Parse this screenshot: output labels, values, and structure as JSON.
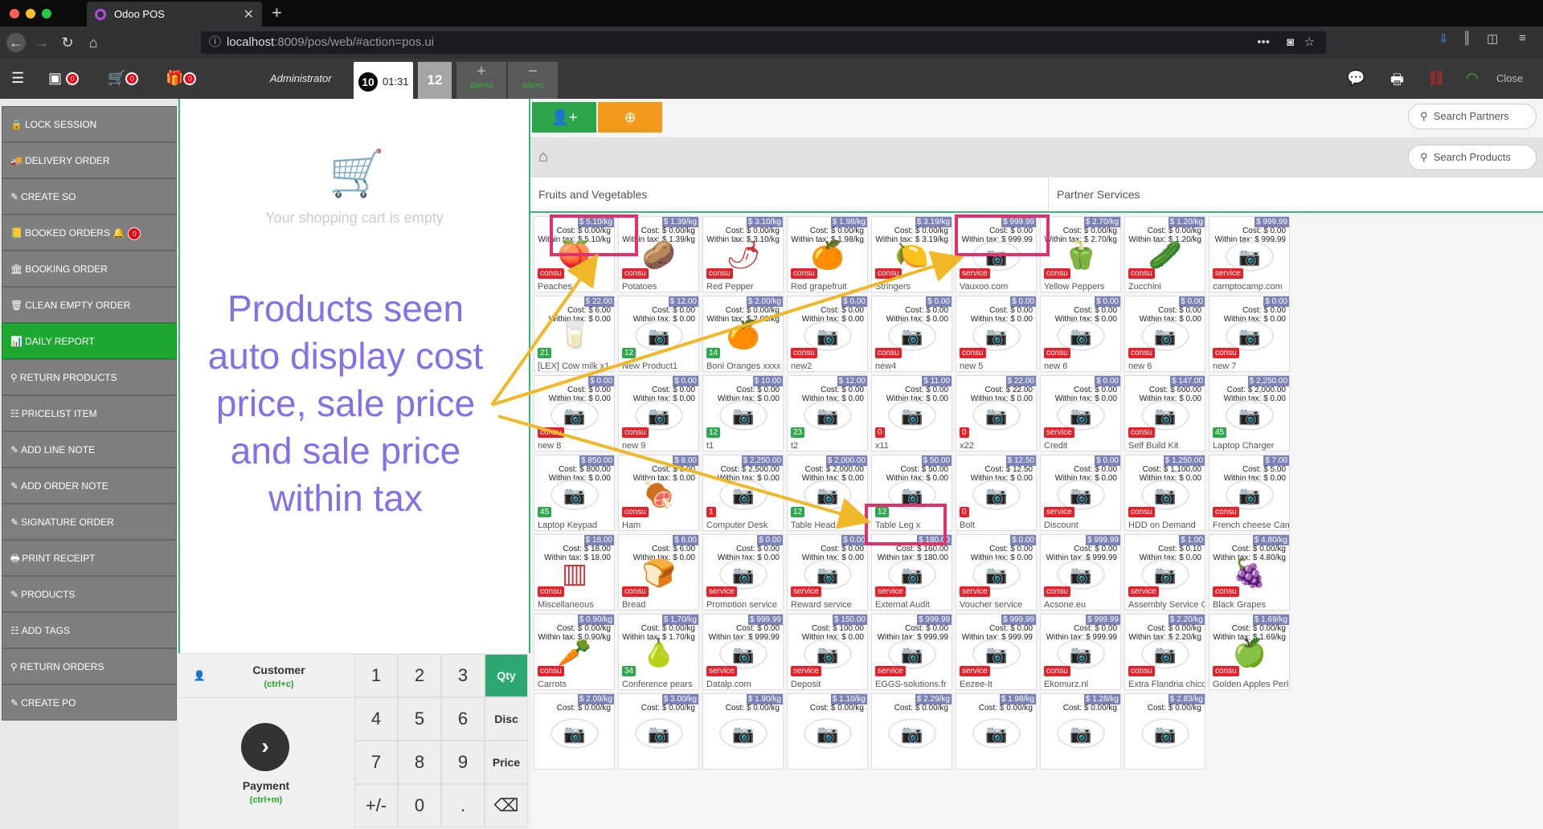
{
  "browser": {
    "tab_title": "Odoo POS",
    "url_host": "localhost",
    "url_port": ":8009",
    "url_path": "/pos/web/#action=pos.ui"
  },
  "header": {
    "cash_count": "0",
    "cart_count": "0",
    "gift_count": "0",
    "admin": "Administrator",
    "order_num": "10",
    "order_time": "01:31",
    "order2": "12",
    "add_hint": "(ctrl+n)",
    "remove_hint": "(ctrl+r)",
    "close": "Close"
  },
  "left_buttons": [
    "LOCK SESSION",
    "DELIVERY ORDER",
    "CREATE SO",
    "BOOKED ORDERS",
    "BOOKING ORDER",
    "CLEAN EMPTY ORDER",
    "DAILY REPORT",
    "RETURN PRODUCTS",
    "PRICELIST ITEM",
    "ADD LINE NOTE",
    "ADD ORDER NOTE",
    "SIGNATURE ORDER",
    "PRINT RECEIPT",
    "PRODUCTS",
    "ADD TAGS",
    "RETURN ORDERS",
    "CREATE PO"
  ],
  "booked_badge": "0",
  "cart": {
    "empty": "Your shopping cart is empty"
  },
  "annotation": "Products seen auto display cost price, sale price and sale price within tax",
  "actionpad": {
    "customer": "Customer",
    "customer_hint": "(ctrl+c)",
    "payment": "Payment",
    "payment_hint": "(ctrl+m)"
  },
  "numpad": {
    "keys": [
      "1",
      "2",
      "3",
      "4",
      "5",
      "6",
      "7",
      "8",
      "9",
      "+/-",
      "0",
      "."
    ],
    "modes": [
      "Qty",
      "Disc",
      "Price"
    ]
  },
  "search": {
    "partners": "Search Partners",
    "products": "Search Products"
  },
  "categories": [
    "Fruits and Vegetables",
    "Partner Services"
  ],
  "products": [
    {
      "name": "Peaches",
      "price": "$ 5.10/kg",
      "cost": "Cost: $ 0.00/kg",
      "tax": "Within tax: $ 5.10/kg",
      "tag": "consu",
      "tc": "red"
    },
    {
      "name": "Potatoes",
      "price": "$ 1.39/kg",
      "cost": "Cost: $ 0.00/kg",
      "tax": "Within tax: $ 1.39/kg",
      "tag": "consu",
      "tc": "red"
    },
    {
      "name": "Red Pepper",
      "price": "$ 3.10/kg",
      "cost": "Cost: $ 0.00/kg",
      "tax": "Within tax: $ 3.10/kg",
      "tag": "consu",
      "tc": "red"
    },
    {
      "name": "Red grapefruit",
      "price": "$ 1.98/kg",
      "cost": "Cost: $ 0.00/kg",
      "tax": "Within tax: $ 1.98/kg",
      "tag": "consu",
      "tc": "red"
    },
    {
      "name": "Stringers",
      "price": "$ 3.19/kg",
      "cost": "Cost: $ 0.00/kg",
      "tax": "Within tax: $ 3.19/kg",
      "tag": "consu",
      "tc": "red"
    },
    {
      "name": "Vauxoo.com",
      "price": "$ 999.99",
      "cost": "Cost: $ 0.00",
      "tax": "Within tax: $ 999.99",
      "tag": "service",
      "tc": "red"
    },
    {
      "name": "Yellow Peppers",
      "price": "$ 2.70/kg",
      "cost": "Cost: $ 0.00/kg",
      "tax": "Within tax: $ 2.70/kg",
      "tag": "consu",
      "tc": "red"
    },
    {
      "name": "Zucchini",
      "price": "$ 1.20/kg",
      "cost": "Cost: $ 0.00/kg",
      "tax": "Within tax: $ 1.20/kg",
      "tag": "consu",
      "tc": "red"
    },
    {
      "name": "camptocamp.com",
      "price": "$ 999.99",
      "cost": "Cost: $ 0.00",
      "tax": "Within tax: $ 999.99",
      "tag": "service",
      "tc": "red"
    },
    {
      "name": "[LEX] Cow milk x1",
      "price": "$ 22.00",
      "cost": "Cost: $ 6.00",
      "tax": "Within tax: $ 0.00",
      "tag": "21",
      "tc": "green"
    },
    {
      "name": "New Product1",
      "price": "$ 12.00",
      "cost": "Cost: $ 0.00",
      "tax": "Within tax: $ 0.00",
      "tag": "12",
      "tc": "green"
    },
    {
      "name": "Boni Oranges xxxx",
      "price": "$ 2.00/kg",
      "cost": "Cost: $ 0.00/kg",
      "tax": "Within tax: $ 2.00/kg",
      "tag": "14",
      "tc": "green"
    },
    {
      "name": "new2",
      "price": "$ 0.00",
      "cost": "Cost: $ 0.00",
      "tax": "Within tax: $ 0.00",
      "tag": "consu",
      "tc": "red"
    },
    {
      "name": "new4",
      "price": "$ 0.00",
      "cost": "Cost: $ 0.00",
      "tax": "Within tax: $ 0.00",
      "tag": "consu",
      "tc": "red"
    },
    {
      "name": "new 5",
      "price": "$ 0.00",
      "cost": "Cost: $ 0.00",
      "tax": "Within tax: $ 0.00",
      "tag": "consu",
      "tc": "red"
    },
    {
      "name": "new 6",
      "price": "$ 0.00",
      "cost": "Cost: $ 0.00",
      "tax": "Within tax: $ 0.00",
      "tag": "consu",
      "tc": "red"
    },
    {
      "name": "new 6",
      "price": "$ 0.00",
      "cost": "Cost: $ 0.00",
      "tax": "Within tax: $ 0.00",
      "tag": "consu",
      "tc": "red"
    },
    {
      "name": "new 7",
      "price": "$ 0.00",
      "cost": "Cost: $ 0.00",
      "tax": "Within tax: $ 0.00",
      "tag": "consu",
      "tc": "red"
    },
    {
      "name": "new 8",
      "price": "$ 0.00",
      "cost": "Cost: $ 0.00",
      "tax": "Within tax: $ 0.00",
      "tag": "consu",
      "tc": "red"
    },
    {
      "name": "new 9",
      "price": "$ 0.00",
      "cost": "Cost: $ 0.00",
      "tax": "Within tax: $ 0.00",
      "tag": "consu",
      "tc": "red"
    },
    {
      "name": "t1",
      "price": "$ 10.00",
      "cost": "Cost: $ 0.00",
      "tax": "Within tax: $ 0.00",
      "tag": "12",
      "tc": "green"
    },
    {
      "name": "t2",
      "price": "$ 12.00",
      "cost": "Cost: $ 0.00",
      "tax": "Within tax: $ 0.00",
      "tag": "23",
      "tc": "green"
    },
    {
      "name": "x11",
      "price": "$ 11.00",
      "cost": "Cost: $ 0.00",
      "tax": "Within tax: $ 0.00",
      "tag": "0",
      "tc": "red"
    },
    {
      "name": "x22",
      "price": "$ 22.00",
      "cost": "Cost: $ 22.00",
      "tax": "Within tax: $ 0.00",
      "tag": "0",
      "tc": "red"
    },
    {
      "name": "Credit",
      "price": "$ 0.00",
      "cost": "Cost: $ 0.00",
      "tax": "Within tax: $ 0.00",
      "tag": "service",
      "tc": "red"
    },
    {
      "name": "Self Build Kit",
      "price": "$ 147.00",
      "cost": "Cost: $ 600.00",
      "tax": "Within tax: $ 0.00",
      "tag": "consu",
      "tc": "red"
    },
    {
      "name": "Laptop Charger",
      "price": "$ 2,250.00",
      "cost": "Cost: $ 2,000.00",
      "tax": "Within tax: $ 0.00",
      "tag": "45",
      "tc": "green"
    },
    {
      "name": "Laptop Keypad",
      "price": "$ 850.00",
      "cost": "Cost: $ 800.00",
      "tax": "Within tax: $ 0.00",
      "tag": "45",
      "tc": "green"
    },
    {
      "name": "Ham",
      "price": "$ 8.00",
      "cost": "Cost: $ 6.00",
      "tax": "Within tax: $ 0.00",
      "tag": "consu",
      "tc": "red"
    },
    {
      "name": "Computer Desk",
      "price": "$ 2,250.00",
      "cost": "Cost: $ 2,500.00",
      "tax": "Within tax: $ 0.00",
      "tag": "1",
      "tc": "red"
    },
    {
      "name": "Table Head x",
      "price": "$ 2,000.00",
      "cost": "Cost: $ 2,000.00",
      "tax": "Within tax: $ 0.00",
      "tag": "12",
      "tc": "green"
    },
    {
      "name": "Table Leg x",
      "price": "$ 50.00",
      "cost": "Cost: $ 50.00",
      "tax": "Within tax: $ 0.00",
      "tag": "12",
      "tc": "green"
    },
    {
      "name": "Bolt",
      "price": "$ 12.50",
      "cost": "Cost: $ 12.50",
      "tax": "Within tax: $ 0.00",
      "tag": "0",
      "tc": "red"
    },
    {
      "name": "Discount",
      "price": "$ 0.00",
      "cost": "Cost: $ 0.00",
      "tax": "Within tax: $ 0.00",
      "tag": "service",
      "tc": "red"
    },
    {
      "name": "HDD on Demand",
      "price": "$ 1,250.00",
      "cost": "Cost: $ 1,100.00",
      "tax": "Within tax: $ 0.00",
      "tag": "consu",
      "tc": "red"
    },
    {
      "name": "French cheese Camembert",
      "price": "$ 7.00",
      "cost": "Cost: $ 5.00",
      "tax": "Within tax: $ 0.00",
      "tag": "consu",
      "tc": "red"
    },
    {
      "name": "Miscellaneous",
      "price": "$ 18.00",
      "cost": "Cost: $ 18.00",
      "tax": "Within tax: $ 18.00",
      "tag": "consu",
      "tc": "red"
    },
    {
      "name": "Bread",
      "price": "$ 8.00",
      "cost": "Cost: $ 6.00",
      "tax": "Within tax: $ 0.00",
      "tag": "consu",
      "tc": "red"
    },
    {
      "name": "Promotion service",
      "price": "$ 0.00",
      "cost": "Cost: $ 0.00",
      "tax": "Within tax: $ 0.00",
      "tag": "service",
      "tc": "red"
    },
    {
      "name": "Reward service",
      "price": "$ 0.00",
      "cost": "Cost: $ 0.00",
      "tax": "Within tax: $ 0.00",
      "tag": "service",
      "tc": "red"
    },
    {
      "name": "External Audit",
      "price": "$ 180.00",
      "cost": "Cost: $ 160.00",
      "tax": "Within tax: $ 180.00",
      "tag": "service",
      "tc": "red"
    },
    {
      "name": "Voucher service",
      "price": "$ 0.00",
      "cost": "Cost: $ 0.00",
      "tax": "Within tax: $ 0.00",
      "tag": "service",
      "tc": "red"
    },
    {
      "name": "Acsone.eu",
      "price": "$ 999.99",
      "cost": "Cost: $ 0.00",
      "tax": "Within tax: $ 999.99",
      "tag": "consu",
      "tc": "red"
    },
    {
      "name": "Assembly Service Cost",
      "price": "$ 1.00",
      "cost": "Cost: $ 0.10",
      "tax": "Within tax: $ 0.00",
      "tag": "service",
      "tc": "red"
    },
    {
      "name": "Black Grapes",
      "price": "$ 4.80/kg",
      "cost": "Cost: $ 0.00/kg",
      "tax": "Within tax: $ 4.80/kg",
      "tag": "consu",
      "tc": "red"
    },
    {
      "name": "Carrots",
      "price": "$ 0.90/kg",
      "cost": "Cost: $ 0.00/kg",
      "tax": "Within tax: $ 0.90/kg",
      "tag": "consu",
      "tc": "red"
    },
    {
      "name": "Conference pears",
      "price": "$ 1.70/kg",
      "cost": "Cost: $ 0.00/kg",
      "tax": "Within tax: $ 1.70/kg",
      "tag": "34",
      "tc": "green"
    },
    {
      "name": "Datalp.com",
      "price": "$ 999.99",
      "cost": "Cost: $ 0.00",
      "tax": "Within tax: $ 999.99",
      "tag": "service",
      "tc": "red"
    },
    {
      "name": "Deposit",
      "price": "$ 150.00",
      "cost": "Cost: $ 100.00",
      "tax": "Within tax: $ 0.00",
      "tag": "service",
      "tc": "red"
    },
    {
      "name": "EGGS-solutions.fr",
      "price": "$ 999.99",
      "cost": "Cost: $ 0.00",
      "tax": "Within tax: $ 999.99",
      "tag": "service",
      "tc": "red"
    },
    {
      "name": "Eezee-It",
      "price": "$ 999.99",
      "cost": "Cost: $ 0.00",
      "tax": "Within tax: $ 999.99",
      "tag": "service",
      "tc": "red"
    },
    {
      "name": "Ekomurz.nl",
      "price": "$ 999.99",
      "cost": "Cost: $ 0.00",
      "tax": "Within tax: $ 999.99",
      "tag": "consu",
      "tc": "red"
    },
    {
      "name": "Extra Flandria chicory",
      "price": "$ 2.20/kg",
      "cost": "Cost: $ 0.00/kg",
      "tax": "Within tax: $ 2.20/kg",
      "tag": "consu",
      "tc": "red"
    },
    {
      "name": "Golden Apples Perlim",
      "price": "$ 1.69/kg",
      "cost": "Cost: $ 0.00/kg",
      "tax": "Within tax: $ 1.69/kg",
      "tag": "consu",
      "tc": "red"
    },
    {
      "name": "",
      "price": "$ 2.09/kg",
      "cost": "Cost: $ 0.00/kg",
      "tax": "",
      "tag": "",
      "tc": ""
    },
    {
      "name": "",
      "price": "$ 3.00/kg",
      "cost": "Cost: $ 0.00/kg",
      "tax": "",
      "tag": "",
      "tc": ""
    },
    {
      "name": "",
      "price": "$ 1.90/kg",
      "cost": "Cost: $ 0.00/kg",
      "tax": "",
      "tag": "",
      "tc": ""
    },
    {
      "name": "",
      "price": "$ 1.10/kg",
      "cost": "Cost: $ 0.00/kg",
      "tax": "",
      "tag": "",
      "tc": ""
    },
    {
      "name": "",
      "price": "$ 2.29/kg",
      "cost": "Cost: $ 0.00/kg",
      "tax": "",
      "tag": "",
      "tc": ""
    },
    {
      "name": "",
      "price": "$ 1.98/kg",
      "cost": "Cost: $ 0.00/kg",
      "tax": "",
      "tag": "",
      "tc": ""
    },
    {
      "name": "",
      "price": "$ 1.28/kg",
      "cost": "Cost: $ 0.00/kg",
      "tax": "",
      "tag": "",
      "tc": ""
    },
    {
      "name": "",
      "price": "$ 2.83/kg",
      "cost": "Cost: $ 0.00/kg",
      "tax": "",
      "tag": "",
      "tc": ""
    }
  ],
  "colors": {
    "accent": "#3bb57a",
    "badge": "#e8202a",
    "price_tag": "#7a82b8",
    "annotation": "#8470e8",
    "highlight": "#e0306e",
    "arrow": "#f0b828"
  }
}
